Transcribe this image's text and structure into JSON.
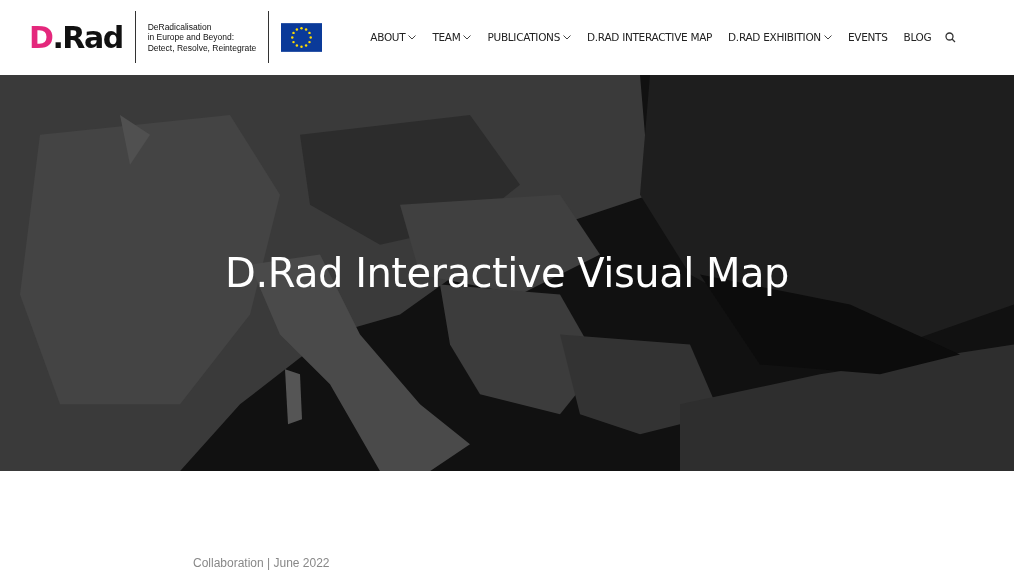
{
  "logo": {
    "mark": "D.Rad",
    "tagline": [
      "DeRadicalisation",
      "in Europe and Beyond:",
      "Detect, Resolve, Reintegrate"
    ]
  },
  "nav": [
    {
      "label": "ABOUT",
      "has_dropdown": true
    },
    {
      "label": "TEAM",
      "has_dropdown": true
    },
    {
      "label": "PUBLICATIONS",
      "has_dropdown": true
    },
    {
      "label": "D.RAD INTERACTIVE MAP",
      "has_dropdown": false
    },
    {
      "label": "D.RAD EXHIBITION",
      "has_dropdown": true
    },
    {
      "label": "EVENTS",
      "has_dropdown": false
    },
    {
      "label": "BLOG",
      "has_dropdown": false
    }
  ],
  "hero": {
    "kind": "picture",
    "title": "D.Rad Interactive Visual Map"
  },
  "meta": "Collaboration | June 2022"
}
